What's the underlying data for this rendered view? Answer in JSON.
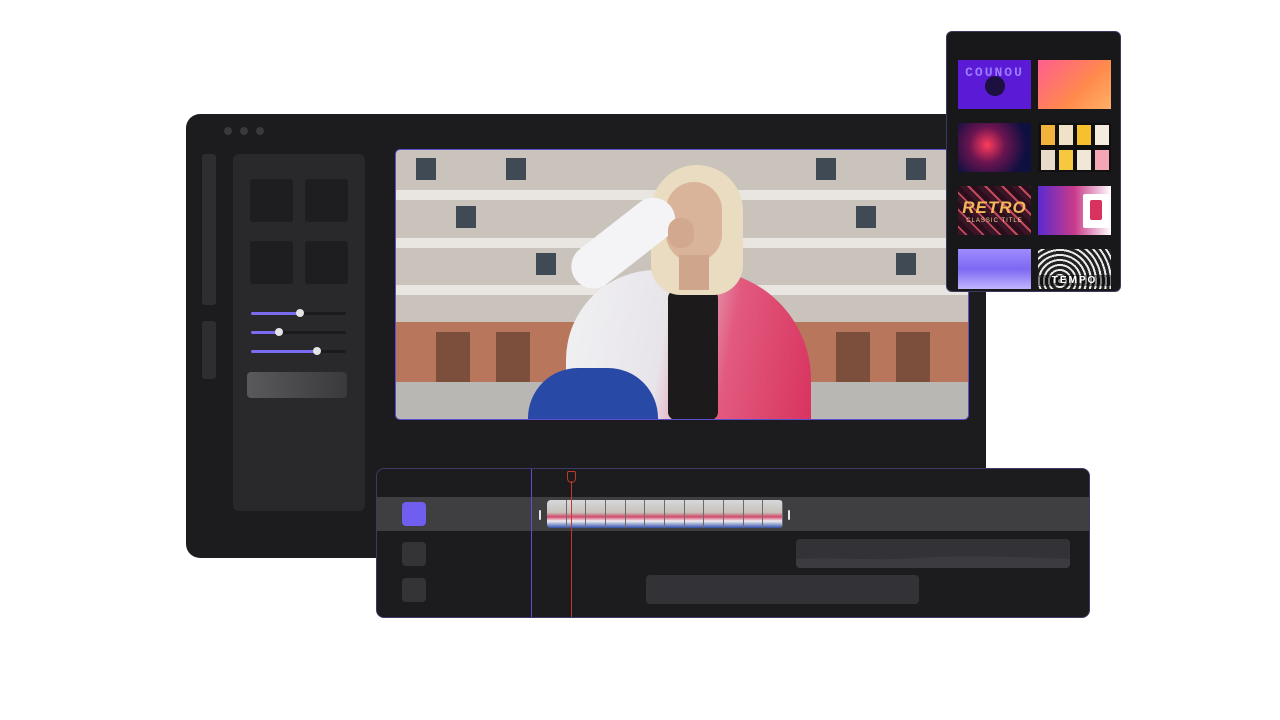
{
  "colors": {
    "accent": "#7a6cf0",
    "window_bg": "#1c1b1d",
    "panel_bg": "#29282b",
    "playhead": "#c0392b"
  },
  "effects_panel": {
    "sliders": [
      {
        "name": "slider-1",
        "value": 0.52
      },
      {
        "name": "slider-2",
        "value": 0.29
      },
      {
        "name": "slider-3",
        "value": 0.69
      }
    ]
  },
  "gallery": {
    "thumbs": [
      {
        "name": "typo-blue",
        "text": "COUNOU"
      },
      {
        "name": "gradient-orange",
        "text": ""
      },
      {
        "name": "neon-helmet",
        "text": ""
      },
      {
        "name": "photo-grid",
        "text": ""
      },
      {
        "name": "retro-title",
        "title": "RETRO",
        "subtitle": "CLASSIC TITLE"
      },
      {
        "name": "collage",
        "text": ""
      },
      {
        "name": "purple-waves",
        "text": ""
      },
      {
        "name": "bw-tempo",
        "text": "TEMPO"
      }
    ]
  },
  "timeline": {
    "clip_frames": 12
  }
}
